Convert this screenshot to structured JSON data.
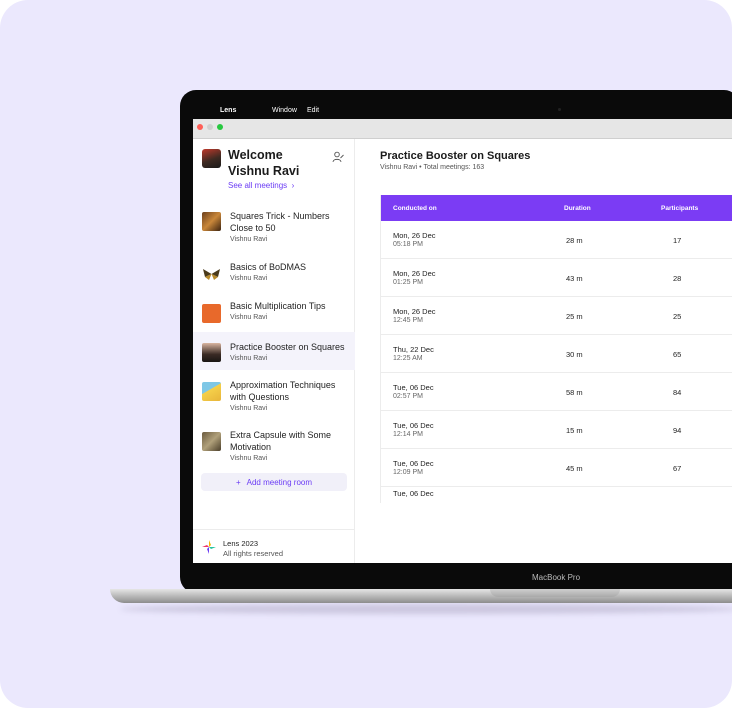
{
  "menubar": {
    "app": "Lens",
    "menu1": "Window",
    "menu2": "Edit"
  },
  "sidebar": {
    "welcome": "Welcome Vishnu Ravi",
    "see_all": "See all meetings",
    "meetings": [
      {
        "title": "Squares Trick - Numbers Close to 50",
        "host": "Vishnu Ravi"
      },
      {
        "title": "Basics of BoDMAS",
        "host": "Vishnu Ravi"
      },
      {
        "title": "Basic Multiplication Tips",
        "host": "Vishnu Ravi"
      },
      {
        "title": "Practice Booster on Squares",
        "host": "Vishnu Ravi"
      },
      {
        "title": "Approximation Techniques with Questions",
        "host": "Vishnu Ravi"
      },
      {
        "title": "Extra Capsule with Some Motivation",
        "host": "Vishnu Ravi"
      }
    ],
    "add_room": "Add meeting room",
    "add_icon": "+",
    "footer": {
      "name": "Lens 2023",
      "rights": "All rights reserved"
    }
  },
  "main": {
    "title": "Practice Booster on Squares",
    "subtitle": "Vishnu Ravi  •  Total meetings: 163",
    "table": {
      "headers": [
        "Conducted on",
        "Duration",
        "Participants"
      ],
      "rows": [
        {
          "date": "Mon, 26 Dec",
          "time": "05:18 PM",
          "duration": "28 m",
          "participants": "17"
        },
        {
          "date": "Mon, 26 Dec",
          "time": "01:25 PM",
          "duration": "43 m",
          "participants": "28"
        },
        {
          "date": "Mon, 26 Dec",
          "time": "12:45 PM",
          "duration": "25 m",
          "participants": "25"
        },
        {
          "date": "Thu, 22 Dec",
          "time": "12:25 AM",
          "duration": "30 m",
          "participants": "65"
        },
        {
          "date": "Tue, 06 Dec",
          "time": "02:57 PM",
          "duration": "58 m",
          "participants": "84"
        },
        {
          "date": "Tue, 06 Dec",
          "time": "12:14 PM",
          "duration": "15 m",
          "participants": "94"
        },
        {
          "date": "Tue, 06 Dec",
          "time": "12:09 PM",
          "duration": "45 m",
          "participants": "67"
        },
        {
          "date": "Tue, 06 Dec",
          "time": "",
          "duration": "",
          "participants": ""
        }
      ]
    }
  },
  "device_label": "MacBook Pro",
  "colors": {
    "accent": "#7b3cf4",
    "background": "#ebe8fd"
  }
}
